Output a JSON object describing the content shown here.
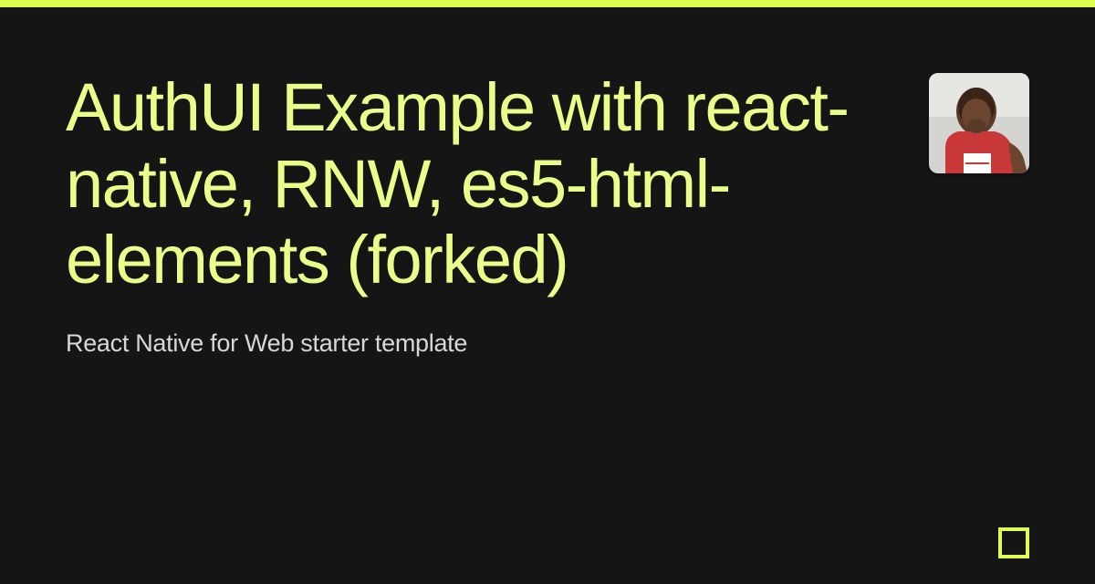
{
  "header": {
    "accent_color": "#dcff50"
  },
  "main": {
    "title": "AuthUI Example with react-native, RNW, es5-html-elements (forked)",
    "subtitle": "React Native for Web starter template"
  },
  "avatar": {
    "label": "user-avatar"
  },
  "brand": {
    "icon": "square-logo",
    "color": "#dcff50"
  }
}
